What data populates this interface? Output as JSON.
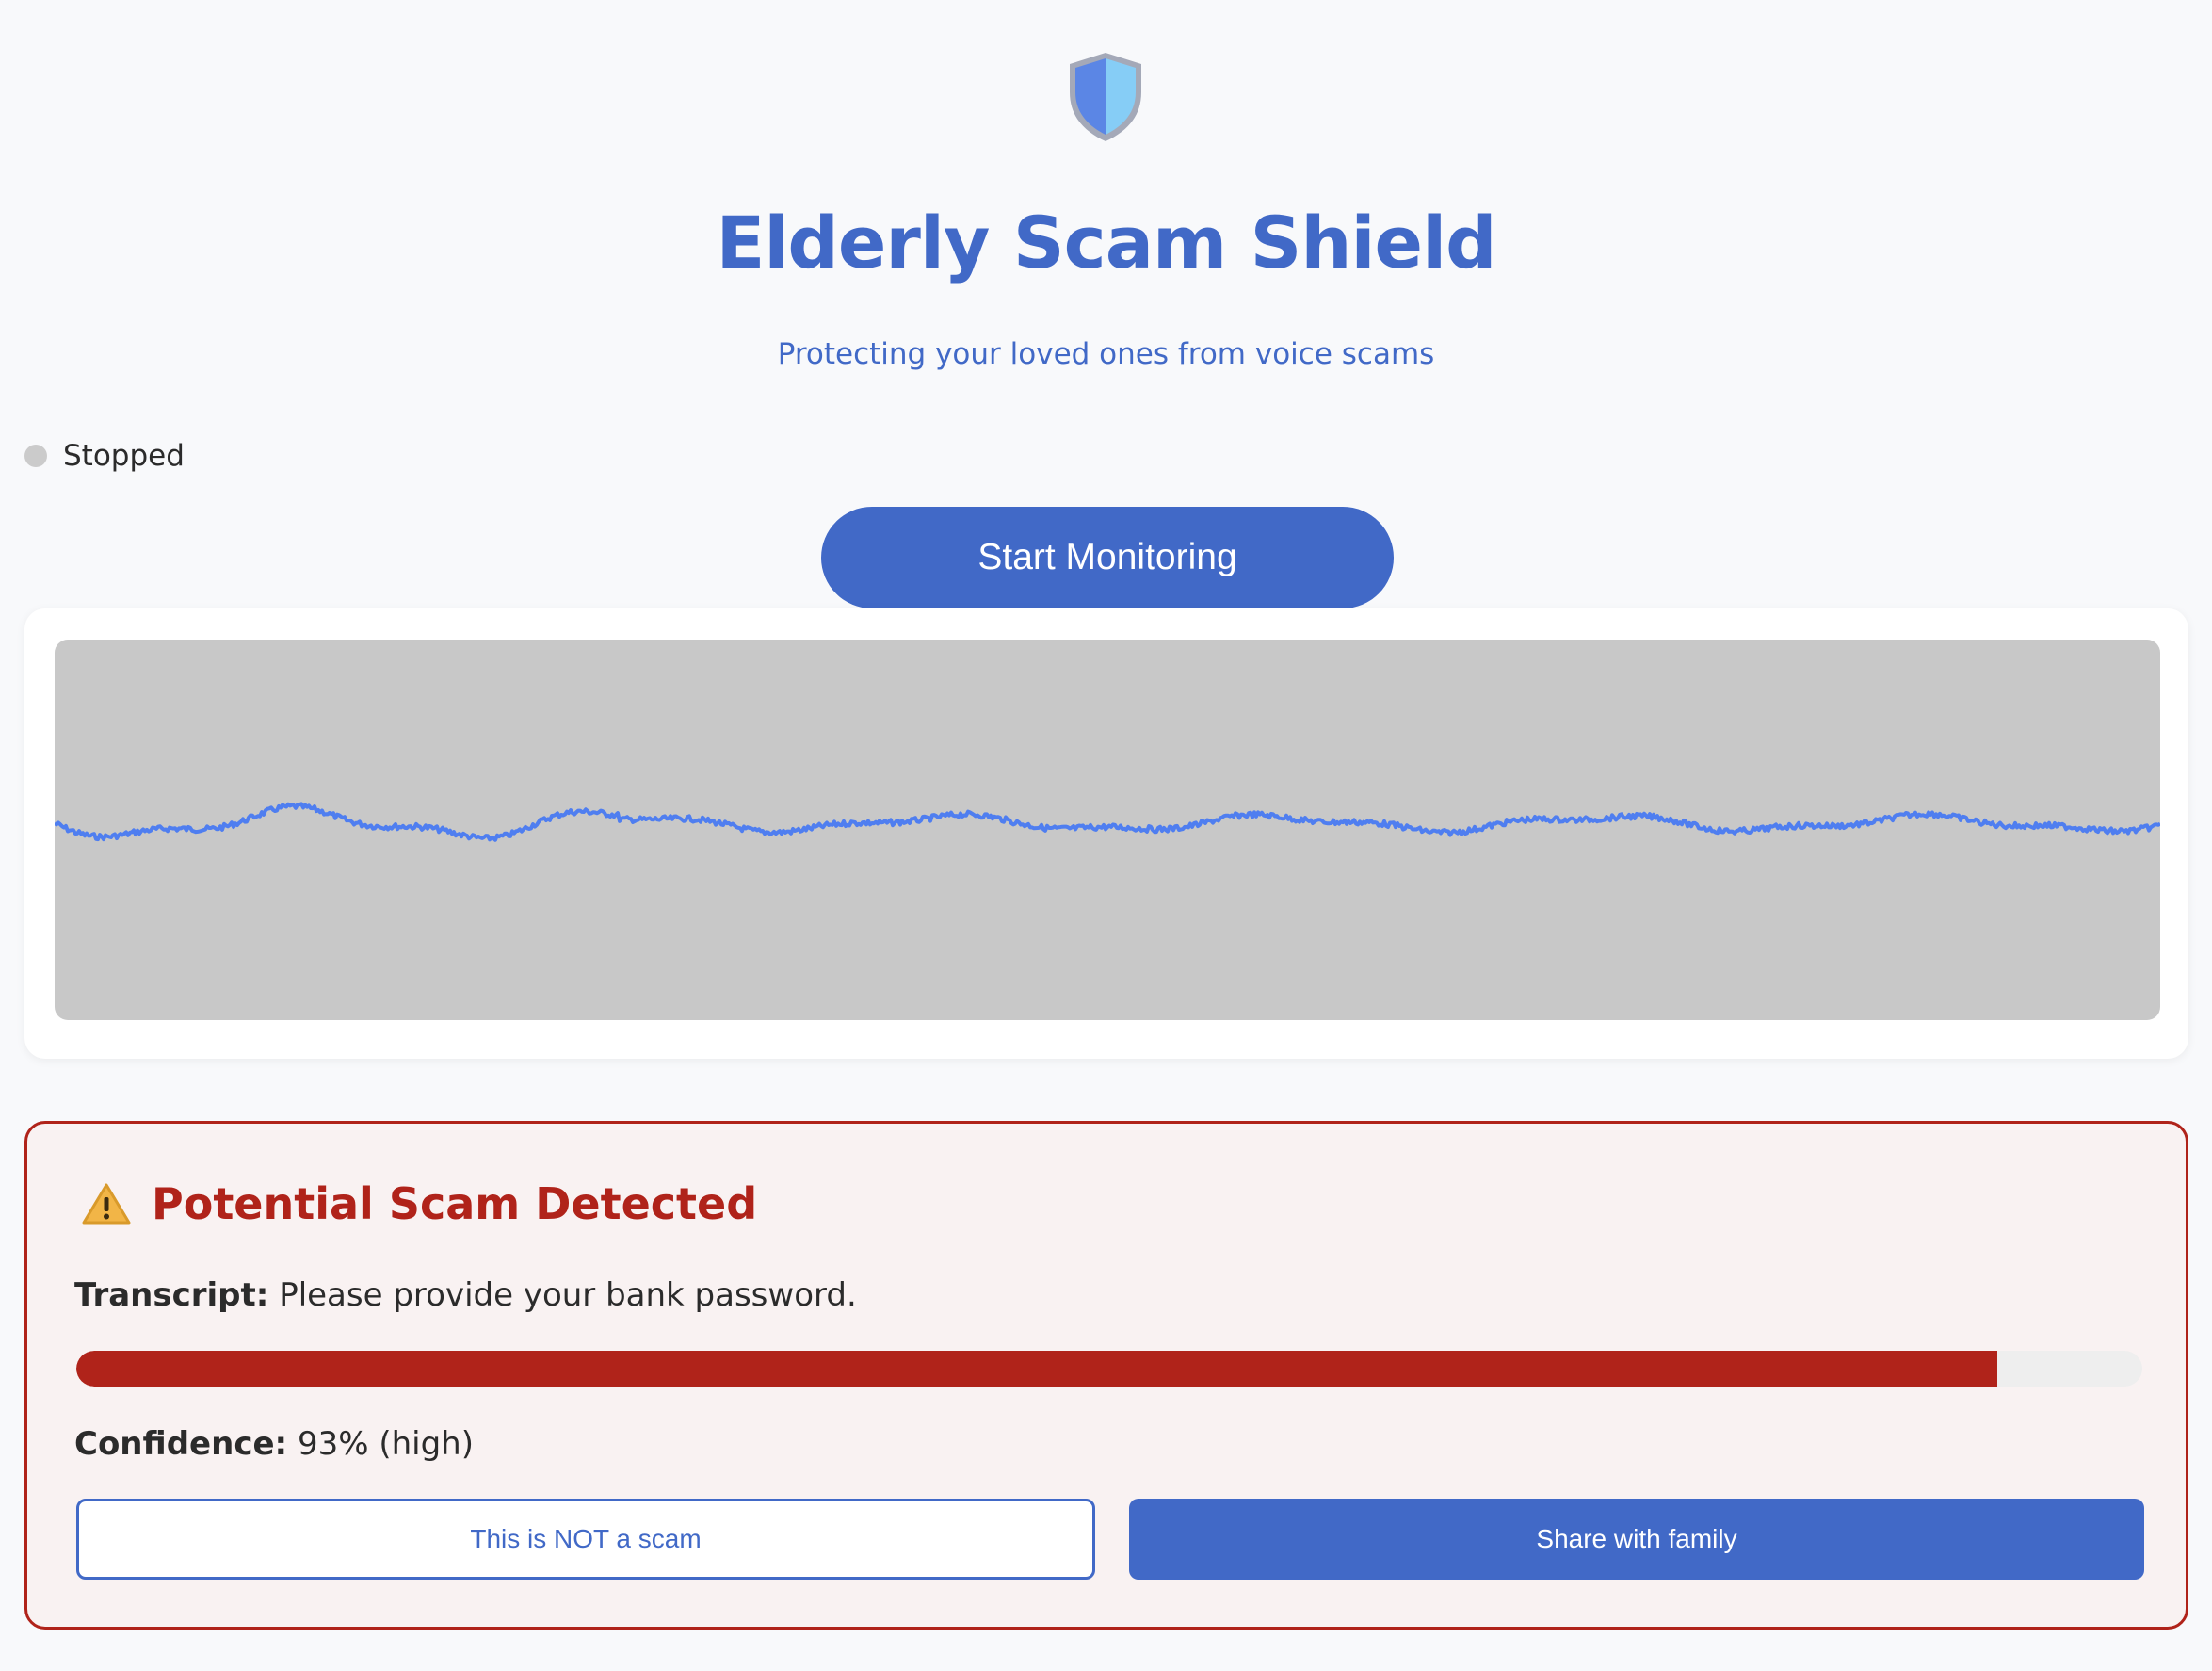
{
  "header": {
    "logo_icon": "shield-icon",
    "title": "Elderly Scam Shield",
    "subtitle": "Protecting your loved ones from voice scams"
  },
  "status": {
    "text": "Stopped",
    "dot_color": "#cbcbcb"
  },
  "controls": {
    "start_label": "Start Monitoring"
  },
  "waveform": {
    "background": "#c8c8c8",
    "line_color": "#4f7ef0"
  },
  "alert": {
    "icon": "warning-icon",
    "title": "Potential Scam Detected",
    "transcript_label": "Transcript:",
    "transcript_text": "Please provide your bank password.",
    "confidence_label": "Confidence:",
    "confidence_text": "93% (high)",
    "confidence_value": 0.93,
    "not_scam_label": "This is NOT a scam",
    "share_label": "Share with family"
  },
  "colors": {
    "accent": "#4169c7",
    "danger": "#b0231a",
    "alert_background": "#f9f2f2"
  }
}
